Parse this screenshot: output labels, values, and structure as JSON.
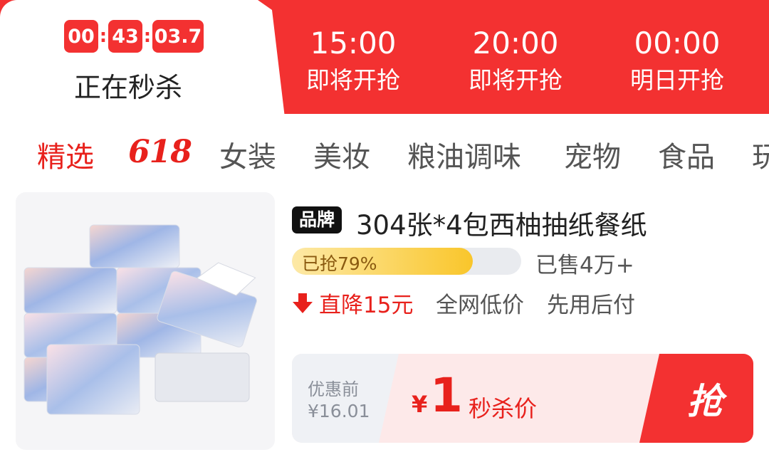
{
  "flash_sale": {
    "active": {
      "countdown": [
        "00",
        "43",
        "03.7"
      ],
      "label": "正在秒杀"
    },
    "slots": [
      {
        "time": "15:00",
        "label": "即将开抢"
      },
      {
        "time": "20:00",
        "label": "即将开抢"
      },
      {
        "time": "00:00",
        "label": "明日开抢"
      }
    ]
  },
  "categories": {
    "items": [
      "精选",
      "618",
      "女装",
      "美妆",
      "粮油调味",
      "宠物",
      "食品",
      "玩"
    ],
    "active_index": 0
  },
  "product": {
    "brand_badge": "品牌",
    "title": "304张*4包西柚抽纸餐纸",
    "progress_text": "已抢79%",
    "progress_fraction": 0.79,
    "sold": "已售4万+",
    "price_drop": "直降15元",
    "tags": [
      "全网低价",
      "先用后付"
    ],
    "original_label": "优惠前",
    "original_price": "¥16.01",
    "currency": "¥",
    "price": "1",
    "price_label": "秒杀价",
    "buy_button": "抢",
    "image_icon": "tissue-pack-product-image"
  },
  "colors": {
    "accent_red": "#f33131",
    "price_red": "#e8211c",
    "progress_yellow": "#f9c62b"
  }
}
